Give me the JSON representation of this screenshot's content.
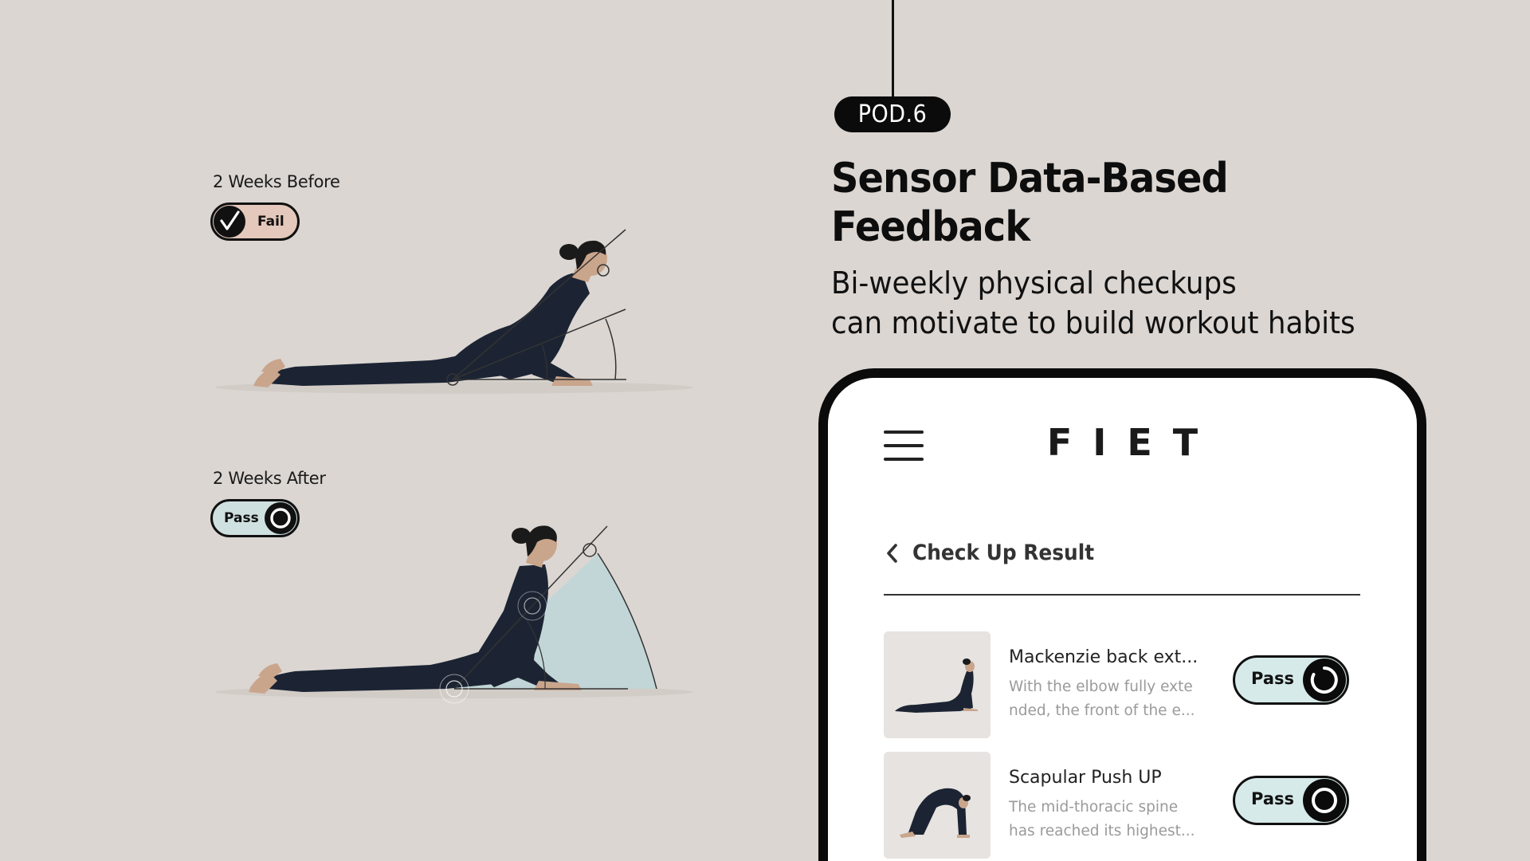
{
  "badge": {
    "label": "POD.6"
  },
  "headline": {
    "line1": "Sensor Data-Based",
    "line2": "Feedback"
  },
  "subline": {
    "line1": "Bi-weekly physical checkups",
    "line2": "can motivate to build workout habits"
  },
  "comparison": {
    "before": {
      "label": "2 Weeks Before",
      "status": "Fail",
      "status_icon": "checkmark-icon"
    },
    "after": {
      "label": "2 Weeks After",
      "status": "Pass",
      "status_icon": "circle-icon"
    }
  },
  "app": {
    "brand": "FIET",
    "menu_icon": "hamburger-menu-icon",
    "back_icon": "chevron-left-icon",
    "section_title": "Check Up Result",
    "results": [
      {
        "title": "Mackenzie back ext...",
        "desc_line1": "With the elbow fully exte",
        "desc_line2": "nded, the front of the e...",
        "status": "Pass",
        "status_icon": "progress-ring-icon"
      },
      {
        "title": "Scapular Push UP",
        "desc_line1": "The mid-thoracic spine",
        "desc_line2": "has reached its highest...",
        "status": "Pass",
        "status_icon": "circle-icon"
      }
    ]
  },
  "colors": {
    "background": "#dbd6d2",
    "fail_fill": "#e4c8bb",
    "pass_fill": "#cfe0e0",
    "ink": "#0b0b0b",
    "angle_fill": "#b9d6d8"
  }
}
